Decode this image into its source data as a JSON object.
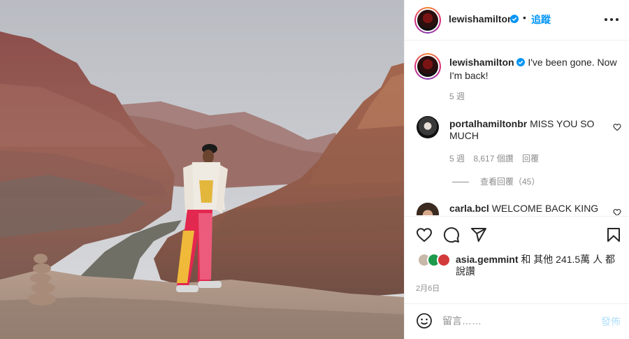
{
  "post": {
    "photo_alt": "Man standing on a rock ledge above a canyon"
  },
  "header": {
    "username": "lewishamilton",
    "separator": "•",
    "follow_label": "追蹤"
  },
  "caption": {
    "username": "lewishamilton",
    "text": "I've been gone. Now I'm back!",
    "time": "5 週"
  },
  "comments": [
    {
      "username": "portalhamiltonbr",
      "text": "MISS YOU SO MUCH",
      "time": "5 週",
      "likes": "8,617 個讚",
      "reply_label": "回覆",
      "view_replies": "查看回覆（45）"
    },
    {
      "username": "carla.bcl",
      "text": "WELCOME BACK KING"
    }
  ],
  "likes": {
    "username": "asia.gemmint",
    "text": " 和 其他 241.5萬 人 都說讚"
  },
  "date": "2月6日",
  "add_comment": {
    "placeholder": "留言……",
    "post_label": "發佈"
  },
  "icons": {
    "more": "more-options-icon",
    "verified": "verified-badge-icon",
    "like": "heart-icon",
    "comment": "comment-icon",
    "share": "share-icon",
    "save": "bookmark-icon",
    "emoji": "emoji-icon"
  },
  "colors": {
    "link_blue": "#0095f6",
    "verified_blue": "#0095f6",
    "muted_text": "#8e8e8e",
    "post_disabled": "#b2dffc"
  }
}
